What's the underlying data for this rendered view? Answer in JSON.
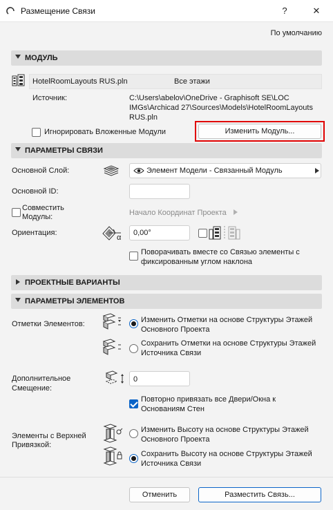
{
  "window": {
    "title": "Размещение Связи",
    "help_label": "?",
    "close_label": "✕",
    "accent_color": "#0a64c8",
    "highlight_color": "#e00000"
  },
  "defaults_link": "По умолчанию",
  "sections": {
    "module": "МОДУЛЬ",
    "link_params": "ПАРАМЕТРЫ СВЯЗИ",
    "design_options": "ПРОЕКТНЫЕ ВАРИАНТЫ",
    "element_params": "ПАРАМЕТРЫ ЭЛЕМЕНТОВ"
  },
  "module": {
    "file_name": "HotelRoomLayouts RUS.pln",
    "stories": "Все этажи",
    "source_label": "Источник:",
    "source_line1": "C:\\Users\\abelov\\OneDrive - Graphisoft SE\\LOC",
    "source_line2": "IMGs\\Archicad 27\\Sources\\Models\\HotelRoomLayouts",
    "source_line3": "RUS.pln",
    "ignore_nested_label": "Игнорировать Вложенные Модули",
    "ignore_nested_checked": false,
    "change_module_button": "Изменить Модуль..."
  },
  "link_params": {
    "master_layer_label": "Основной Слой:",
    "master_layer_value": "Элемент Модели - Связанный Модуль",
    "master_id_label": "Основной ID:",
    "master_id_value": "",
    "align_label_line1": "Совместить",
    "align_label_line2": "Модулы:",
    "align_checked": false,
    "align_target": "Начало Координат Проекта",
    "orientation_label": "Ориентация:",
    "orientation_value": "0,00°",
    "alpha_symbol": "α",
    "mirror_checked": false,
    "rotate_fixed_line1": "Поворачивать вместе со Связью элементы с",
    "rotate_fixed_line2": "фиксированным углом наклона",
    "rotate_fixed_checked": false
  },
  "element_params": {
    "elevations_label": "Отметки Элементов:",
    "elev_opt1_line1": "Изменить Отметки на основе Структуры Этажей",
    "elev_opt1_line2": "Основного Проекта",
    "elev_opt1_selected": true,
    "elev_opt2_line1": "Сохранить Отметки на основе Структуры Этажей",
    "elev_opt2_line2": "Источника Связи",
    "elev_opt2_selected": false,
    "offset_label_line1": "Дополнительное",
    "offset_label_line2": "Смещение:",
    "offset_value": "0",
    "reconnect_line1": "Повторно привязать все Двери/Окна к",
    "reconnect_line2": "Основаниям Стен",
    "reconnect_checked": true,
    "top_linked_label_line1": "Элементы с Верхней",
    "top_linked_label_line2": "Привязкой:",
    "top_opt1_line1": "Изменить Высоту на основе Структуры Этажей",
    "top_opt1_line2": "Основного Проекта",
    "top_opt1_selected": false,
    "top_opt2_line1": "Сохранить Высоту на основе Структуры Этажей",
    "top_opt2_line2": "Источника Связи",
    "top_opt2_selected": true
  },
  "footer": {
    "cancel_button": "Отменить",
    "place_button": "Разместить Связь..."
  },
  "icons": [
    "app-link-icon",
    "module-icon",
    "layer-icon",
    "eye-icon",
    "chevron-right-icon",
    "orientation-icon",
    "mirror-icon",
    "elevation-change-icon",
    "elevation-keep-icon",
    "offset-icon",
    "top-link-change-icon",
    "top-link-keep-icon"
  ]
}
